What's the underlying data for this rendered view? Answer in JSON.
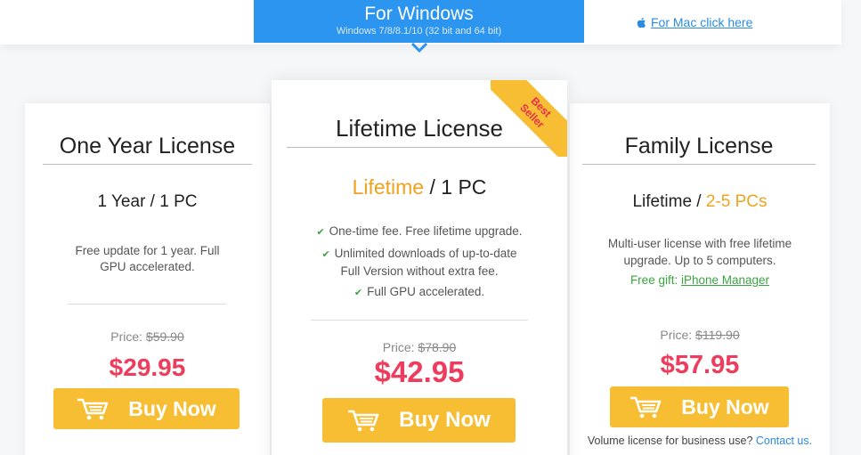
{
  "platform": {
    "windows_title": "For Windows",
    "windows_subtitle": "Windows 7/8/8.1/10 (32 bit and 64 bit)",
    "mac_link": "For Mac click here"
  },
  "colors": {
    "tab_blue": "#2b95f0",
    "accent_orange": "#f0a21e",
    "price_red": "#ee3d5c",
    "button_yellow": "#f7be34",
    "check_green": "#3aa541",
    "link_blue": "#2b8be0"
  },
  "plans": [
    {
      "title": "One Year License",
      "term": "1 Year",
      "separator": " / ",
      "pcs": "1 PC",
      "desc_line1": "Free update for 1 year. Full",
      "desc_line2": "GPU accelerated.",
      "price_label": "Price: ",
      "old_price": "$59.90",
      "price": "$29.95",
      "buy_label": "Buy Now"
    },
    {
      "title": "Lifetime License",
      "term": "Lifetime",
      "separator": " / ",
      "pcs": "1 PC",
      "badge_line1": "Best",
      "badge_line2": "Seller",
      "features": [
        "One-time fee. Free lifetime upgrade.",
        "Unlimited downloads of up-to-date",
        "Full Version without extra fee.",
        "Full GPU accelerated."
      ],
      "price_label": "Price: ",
      "old_price": "$78.90",
      "price": "$42.95",
      "buy_label": "Buy Now"
    },
    {
      "title": "Family License",
      "term": "Lifetime",
      "separator": " / ",
      "pcs": "2-5 PCs",
      "desc_line1": "Multi-user license with free lifetime",
      "desc_line2": "upgrade. Up to 5 computers.",
      "gift_label": "Free gift: ",
      "gift_link": "iPhone Manager",
      "price_label": "Price: ",
      "old_price": "$119.90",
      "price": "$57.95",
      "buy_label": "Buy Now",
      "volume_text": "Volume license for business use? ",
      "contact_link": "Contact us."
    }
  ]
}
